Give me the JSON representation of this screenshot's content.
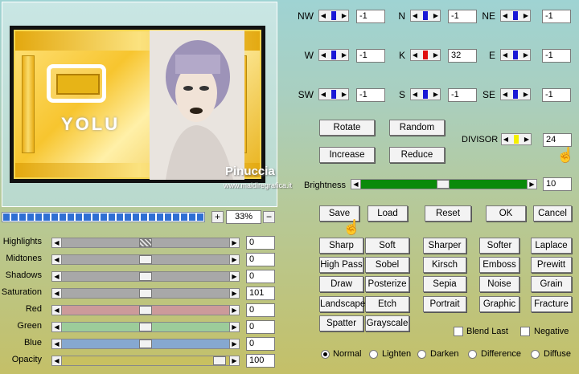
{
  "preview": {
    "art_text": "YOLU",
    "watermark": "Pinuccia",
    "watermark_url": "www.maidiregrafica.it"
  },
  "zoom": {
    "plus": "+",
    "minus": "−",
    "value": "33%"
  },
  "sliders": [
    {
      "label": "Highlights",
      "value": "0",
      "color": "#a8a8a8"
    },
    {
      "label": "Midtones",
      "value": "0",
      "color": "#a8a8a8"
    },
    {
      "label": "Shadows",
      "value": "0",
      "color": "#a8a8a8"
    },
    {
      "label": "Saturation",
      "value": "101",
      "color": "#a8a8a8"
    },
    {
      "label": "Red",
      "value": "0",
      "color": "#cc9a9a"
    },
    {
      "label": "Green",
      "value": "0",
      "color": "#9ccc9a"
    },
    {
      "label": "Blue",
      "value": "0",
      "color": "#86a8d0"
    },
    {
      "label": "Opacity",
      "value": "100",
      "color": "#c8c060"
    }
  ],
  "compass": [
    {
      "label": "NW",
      "value": "-1"
    },
    {
      "label": "N",
      "value": "-1"
    },
    {
      "label": "NE",
      "value": "-1"
    },
    {
      "label": "W",
      "value": "-1"
    },
    {
      "label": "K",
      "value": "32"
    },
    {
      "label": "E",
      "value": "-1"
    },
    {
      "label": "SW",
      "value": "-1"
    },
    {
      "label": "S",
      "value": "-1"
    },
    {
      "label": "SE",
      "value": "-1"
    }
  ],
  "divisor": {
    "label": "DIVISOR",
    "value": "24"
  },
  "brightness": {
    "label": "Brightness",
    "value": "10"
  },
  "matrix_buttons": {
    "rotate": "Rotate",
    "random": "Random",
    "increase": "Increase",
    "reduce": "Reduce"
  },
  "actions": {
    "save": "Save",
    "load": "Load",
    "reset": "Reset",
    "ok": "OK",
    "cancel": "Cancel"
  },
  "presets": [
    [
      "Sharp",
      "Soft",
      "Sharper",
      "Softer",
      "Laplace"
    ],
    [
      "High Pass",
      "Sobel",
      "Kirsch",
      "Emboss",
      "Prewitt"
    ],
    [
      "Draw",
      "Posterize",
      "Sepia",
      "Noise",
      "Grain"
    ],
    [
      "Landscape",
      "Etch",
      "Portrait",
      "Graphic",
      "Fracture"
    ],
    [
      "Spatter",
      "Grayscale"
    ]
  ],
  "checks": {
    "blend_last": "Blend Last",
    "negative": "Negative"
  },
  "blend_modes": {
    "normal": "Normal",
    "lighten": "Lighten",
    "darken": "Darken",
    "difference": "Difference",
    "diffuse": "Diffuse"
  },
  "colors": {
    "accent_blue": "#1a18d6",
    "accent_red": "#e01010",
    "accent_yellow": "#f4f000",
    "brightness_green": "#0a8a0a"
  }
}
